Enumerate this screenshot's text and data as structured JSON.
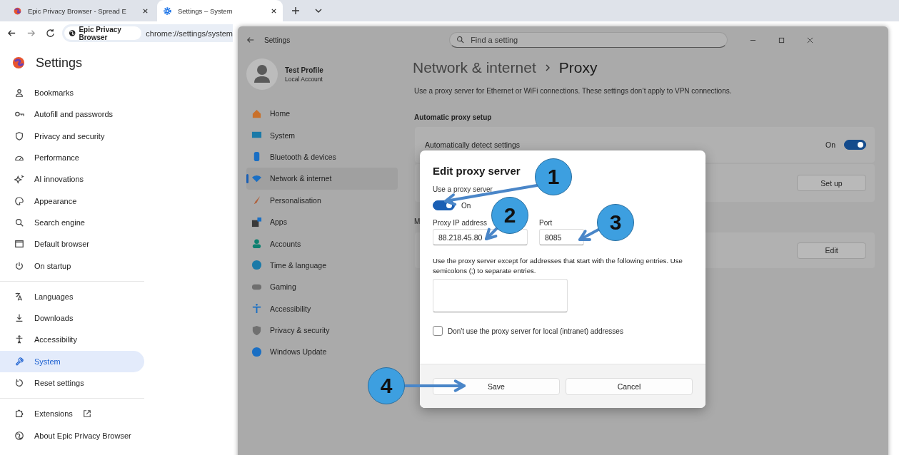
{
  "browser": {
    "tabs": [
      {
        "title": "Epic Privacy Browser - Spread E",
        "selected": false
      },
      {
        "title": "Settings – System",
        "selected": true
      }
    ],
    "site_chip": "Epic Privacy Browser",
    "url": "chrome://settings/system"
  },
  "settings_page": {
    "title": "Settings",
    "groups": [
      [
        {
          "label": "Bookmarks",
          "selected": false
        },
        {
          "label": "Autofill and passwords",
          "selected": false
        },
        {
          "label": "Privacy and security",
          "selected": false
        },
        {
          "label": "Performance",
          "selected": false
        },
        {
          "label": "AI innovations",
          "selected": false
        },
        {
          "label": "Appearance",
          "selected": false
        },
        {
          "label": "Search engine",
          "selected": false
        },
        {
          "label": "Default browser",
          "selected": false
        },
        {
          "label": "On startup",
          "selected": false
        }
      ],
      [
        {
          "label": "Languages",
          "selected": false
        },
        {
          "label": "Downloads",
          "selected": false
        },
        {
          "label": "Accessibility",
          "selected": false
        },
        {
          "label": "System",
          "selected": true
        },
        {
          "label": "Reset settings",
          "selected": false
        }
      ],
      [
        {
          "label": "Extensions",
          "selected": false,
          "external": true
        },
        {
          "label": "About Epic Privacy Browser",
          "selected": false,
          "external": false
        }
      ]
    ]
  },
  "windows_settings": {
    "title": "Settings",
    "search_placeholder": "Find a setting",
    "profile": {
      "name": "Test Profile",
      "account": "Local Account"
    },
    "nav": [
      {
        "label": "Home",
        "selected": false
      },
      {
        "label": "System",
        "selected": false
      },
      {
        "label": "Bluetooth & devices",
        "selected": false
      },
      {
        "label": "Network & internet",
        "selected": true
      },
      {
        "label": "Personalisation",
        "selected": false
      },
      {
        "label": "Apps",
        "selected": false
      },
      {
        "label": "Accounts",
        "selected": false
      },
      {
        "label": "Time & language",
        "selected": false
      },
      {
        "label": "Gaming",
        "selected": false
      },
      {
        "label": "Accessibility",
        "selected": false
      },
      {
        "label": "Privacy & security",
        "selected": false
      },
      {
        "label": "Windows Update",
        "selected": false
      }
    ],
    "breadcrumb": {
      "parent": "Network & internet",
      "current": "Proxy"
    },
    "description": "Use a proxy server for Ethernet or WiFi connections. These settings don’t apply to VPN connections.",
    "automatic_heading": "Automatic proxy setup",
    "auto_detect": {
      "label": "Automatically detect settings",
      "state_text": "On",
      "on": true
    },
    "setup_button": "Set up",
    "manual_heading": "M",
    "edit_button": "Edit"
  },
  "dialog": {
    "title": "Edit proxy server",
    "use_proxy_label": "Use a proxy server",
    "use_proxy": {
      "on": true,
      "state_text": "On"
    },
    "ip_label": "Proxy IP address",
    "ip_value": "88.218.45.80",
    "port_label": "Port",
    "port_value": "8085",
    "exceptions_text": "Use the proxy server except for addresses that start with the following entries. Use semicolons (;) to separate entries.",
    "local_checkbox": {
      "label": "Don't use the proxy server for local (intranet) addresses",
      "checked": false
    },
    "buttons": [
      "Save",
      "Cancel"
    ]
  },
  "callouts": [
    {
      "number": "1"
    },
    {
      "number": "2"
    },
    {
      "number": "3"
    },
    {
      "number": "4"
    }
  ]
}
